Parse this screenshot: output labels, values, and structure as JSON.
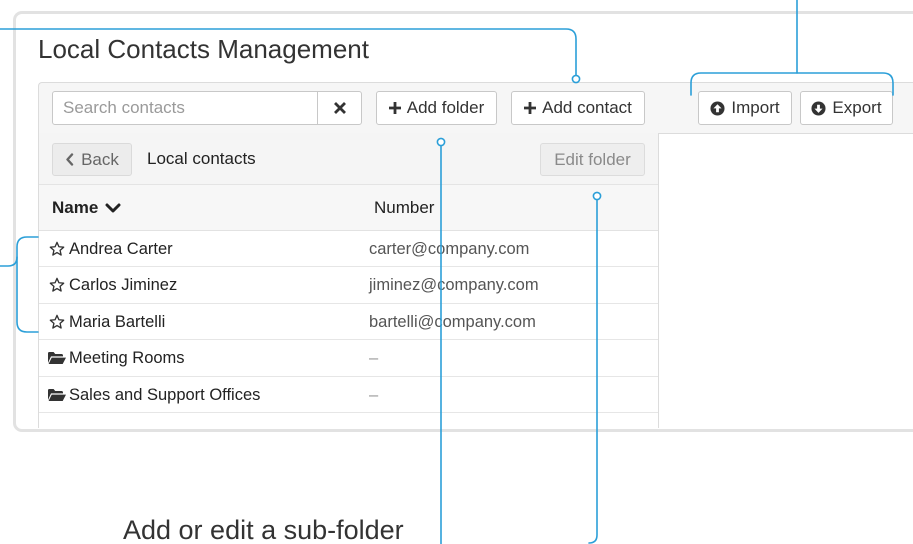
{
  "panel": {
    "title": "Local Contacts Management"
  },
  "toolbar": {
    "search": {
      "placeholder": "Search contacts"
    },
    "clear_icon": "times-icon",
    "add_folder": {
      "label": "Add folder",
      "icon": "plus-icon"
    },
    "add_contact": {
      "label": "Add contact",
      "icon": "plus-icon"
    },
    "import": {
      "label": "Import",
      "icon": "arrow-circle-up-icon"
    },
    "export": {
      "label": "Export",
      "icon": "arrow-circle-down-icon"
    }
  },
  "folder_bar": {
    "back": {
      "label": "Back",
      "icon": "chevron-left-icon"
    },
    "current_folder": "Local contacts",
    "edit_folder": {
      "label": "Edit folder"
    }
  },
  "table": {
    "columns": [
      {
        "label": "Name",
        "icon": "chevron-down-icon"
      },
      {
        "label": "Number"
      }
    ],
    "rows": [
      {
        "icon": "star-outline-icon",
        "name": "Andrea Carter",
        "number": "carter@company.com"
      },
      {
        "icon": "star-outline-icon",
        "name": "Carlos Jiminez",
        "number": "jiminez@company.com"
      },
      {
        "icon": "star-outline-icon",
        "name": "Maria Bartelli",
        "number": "bartelli@company.com"
      },
      {
        "icon": "folder-open-icon",
        "name": "Meeting Rooms",
        "number": "–"
      },
      {
        "icon": "folder-open-icon",
        "name": "Sales and Support Offices",
        "number": "–"
      }
    ]
  },
  "annotations": {
    "subfolder_callout": "Add or edit a sub-folder"
  },
  "colors": {
    "callout_line": "#2b9fd8",
    "toolbar_bg": "#f6f6f6",
    "panel_border": "#e2e2e2",
    "text": "#333333"
  }
}
